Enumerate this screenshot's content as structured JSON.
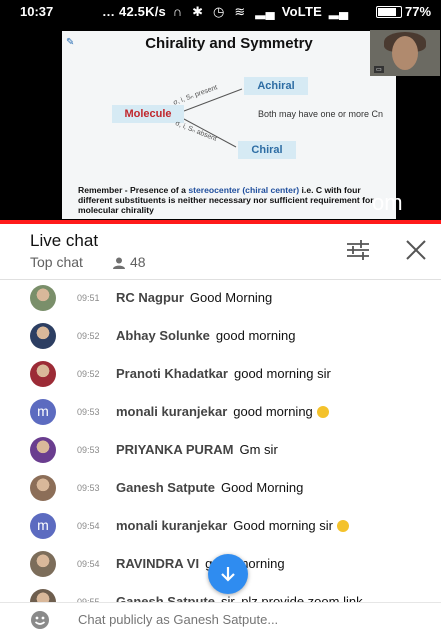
{
  "status_bar": {
    "time": "10:37",
    "network_speed": "42.5K/s",
    "network_label": "VoLTE",
    "battery": "77%"
  },
  "video": {
    "slide": {
      "title": "Chirality and Symmetry",
      "molecule": "Molecule",
      "achiral": "Achiral",
      "chiral": "Chiral",
      "note": "Both may have one or more Cn",
      "branch_top": "σ, i, Sₙ present",
      "branch_bottom": "σ, i, Sₙ absent",
      "remember_lead": "Remember - Presence of a ",
      "remember_hl": "stereocenter (chiral center)",
      "remember_mid": " i.e. C with four different substituents",
      "remember_tail": " is neither necessary nor sufficient requirement for molecular chirality"
    },
    "watermark": "om",
    "progress_fraction": 1.0,
    "accent_color": "#ff1a1a"
  },
  "chat": {
    "title": "Live chat",
    "mode": "Top chat",
    "viewer_count": "48",
    "messages": [
      {
        "time": "09:51",
        "name": "RC Nagpur",
        "text": "Good Morning",
        "avatar": "photo-avatar",
        "emoji": false
      },
      {
        "time": "09:52",
        "name": "Abhay Solunke",
        "text": "good morning",
        "avatar": "photo-avatar",
        "emoji": false
      },
      {
        "time": "09:52",
        "name": "Pranoti Khadatkar",
        "text": "good morning sir",
        "avatar": "photo-avatar",
        "emoji": false
      },
      {
        "time": "09:53",
        "name": "monali kuranjekar",
        "text": "good morning",
        "avatar": "m",
        "emoji": true
      },
      {
        "time": "09:53",
        "name": "PRIYANKA PURAM",
        "text": "Gm sir",
        "avatar": "photo-avatar",
        "emoji": false
      },
      {
        "time": "09:53",
        "name": "Ganesh Satpute",
        "text": "Good Morning",
        "avatar": "photo-avatar",
        "emoji": false
      },
      {
        "time": "09:54",
        "name": "monali kuranjekar",
        "text": "Good morning sir",
        "avatar": "m",
        "emoji": true
      },
      {
        "time": "09:54",
        "name": "RAVINDRA VI",
        "text": "good morning",
        "avatar": "photo-avatar",
        "emoji": false
      },
      {
        "time": "09:55",
        "name": "Ganesh Satpute",
        "text": "sir, plz provide zoom link......",
        "avatar": "photo-avatar",
        "emoji": false
      }
    ],
    "input_placeholder": "Chat publicly as Ganesh Satpute..."
  }
}
